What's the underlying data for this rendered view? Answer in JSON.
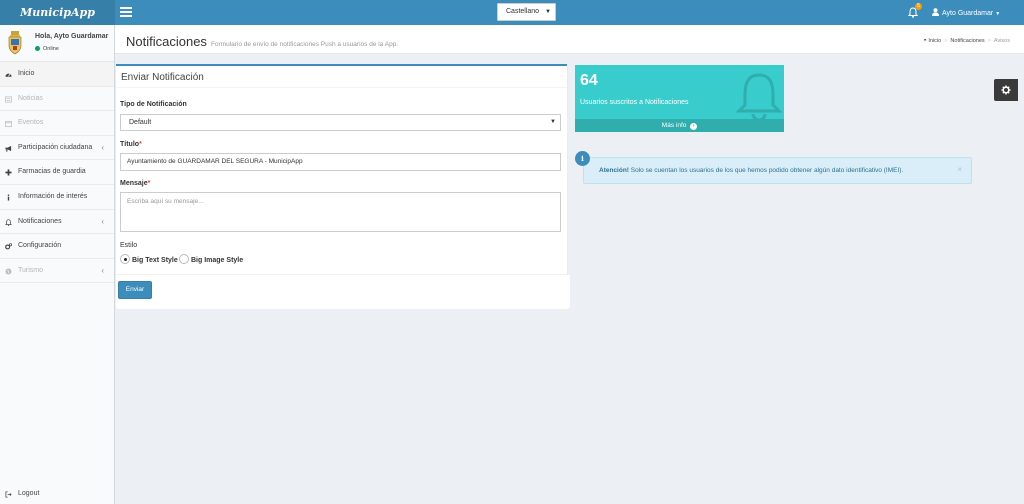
{
  "header": {
    "logo": "MunicipApp",
    "language": "Castellano",
    "notification_count": "5",
    "user_label": "Ayto Guardamar"
  },
  "sidebar": {
    "user_greeting": "Hola, Ayto Guardamar",
    "user_status": "Online",
    "items": [
      {
        "label": "Inicio",
        "icon": "dashboard-icon",
        "active": true
      },
      {
        "label": "Noticias",
        "icon": "newspaper-icon",
        "disabled": true
      },
      {
        "label": "Eventos",
        "icon": "calendar-icon",
        "disabled": true
      },
      {
        "label": "Participación ciudadana",
        "icon": "bullhorn-icon",
        "has_children": true
      },
      {
        "label": "Farmacias de guardia",
        "icon": "plus-icon"
      },
      {
        "label": "Información de interés",
        "icon": "info-icon"
      },
      {
        "label": "Notificaciones",
        "icon": "bell-icon",
        "has_children": true
      },
      {
        "label": "Configuración",
        "icon": "cogs-icon"
      },
      {
        "label": "Turismo",
        "icon": "globe-icon",
        "disabled": true,
        "has_children": true
      }
    ],
    "logout": "Logout"
  },
  "page": {
    "title": "Notificaciones",
    "subtitle": "Formulario de envío de notificaciones Push a usuarios de la App.",
    "breadcrumb": [
      "Inicio",
      "Notificaciones",
      "Avisos"
    ]
  },
  "form": {
    "box_title": "Enviar Notificación",
    "type_label": "Tipo de Notificación",
    "type_value": "Default",
    "title_label": "Título",
    "title_value": "Ayuntamiento de GUARDAMAR DEL SEGURA - MunicipApp",
    "message_label": "Mensaje",
    "message_placeholder": "Escriba aquí su mensaje...",
    "style_label": "Estilo",
    "style_options": [
      "Big Text Style",
      "Big Image Style"
    ],
    "style_selected": "Big Text Style",
    "submit": "Enviar"
  },
  "stats": {
    "number": "64",
    "text": "Usuarios suscritos a Notificaciones",
    "more": "Más info"
  },
  "callout": {
    "strong": "Atención!",
    "text": " Solo se cuentan los usuarios de los que hemos podido obtener algún dato identificativo (IMEI)."
  },
  "colors": {
    "primary": "#3c8dbc",
    "teal": "#39cccc",
    "callout_bg": "#d9eef8"
  }
}
